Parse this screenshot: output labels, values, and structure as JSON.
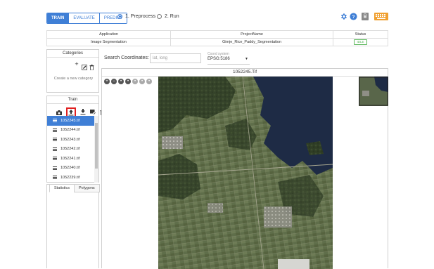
{
  "top": {
    "modes": [
      "TRAIN",
      "EVALUATE",
      "PREDICT"
    ],
    "steps": [
      "1. Preprocess",
      "2. Run"
    ],
    "icons": [
      "settings-icon",
      "help-icon",
      "lock-icon",
      "keyboard-icon"
    ],
    "colors": {
      "accent": "#3f7fd6",
      "settings": "#3f7fd6",
      "keyboard": "#f0a030",
      "idle": "#5cb85c"
    }
  },
  "info": {
    "headers": [
      "Application",
      "ProjectName",
      "Status"
    ],
    "row": {
      "application": "Image Segmentation",
      "project": "Gimje_Rice_Paddy_Segmentation",
      "status": "IDLE"
    }
  },
  "categories": {
    "title": "Categories",
    "empty_text": "Create a new category"
  },
  "train": {
    "title": "Train",
    "files": [
      "1052245.tif",
      "1052244.tif",
      "1052243.tif",
      "1052242.tif",
      "1052241.tif",
      "1052240.tif",
      "1052239.tif"
    ],
    "selected_index": 0
  },
  "bottom_tabs": [
    "Statistics",
    "Polygons"
  ],
  "search": {
    "label": "Search Coordinates:",
    "placeholder": "lat, long",
    "coord_system_label": "Coord system",
    "coord_system_value": "EPSG:5186"
  },
  "viewer": {
    "title": "1052245.Tif"
  }
}
